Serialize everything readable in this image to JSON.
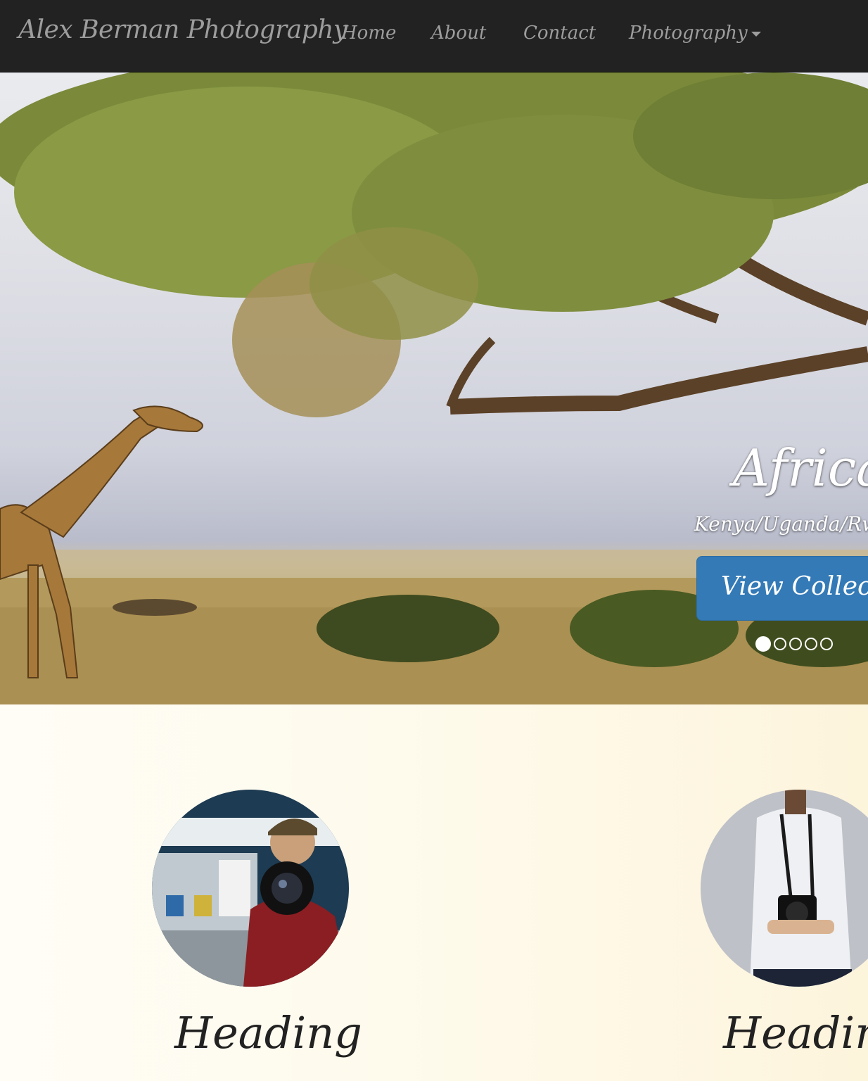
{
  "navbar": {
    "brand": "Alex Berman Photography",
    "links": [
      "Home",
      "About",
      "Contact",
      "Photography"
    ]
  },
  "carousel": {
    "slide": {
      "title": "Africa",
      "subtitle": "Kenya/Uganda/Rwanda",
      "button_label": "View Collection"
    },
    "indicator_count": 5,
    "active_index": 0
  },
  "marketing": {
    "columns": [
      {
        "heading": "Heading",
        "image": "photographer-portrait-1"
      },
      {
        "heading": "Heading",
        "image": "photographer-portrait-2"
      }
    ]
  },
  "colors": {
    "navbar_bg": "#222222",
    "nav_text": "#9d9d9d",
    "primary_button": "#337ab7",
    "section_bg": "#fefaeb"
  }
}
